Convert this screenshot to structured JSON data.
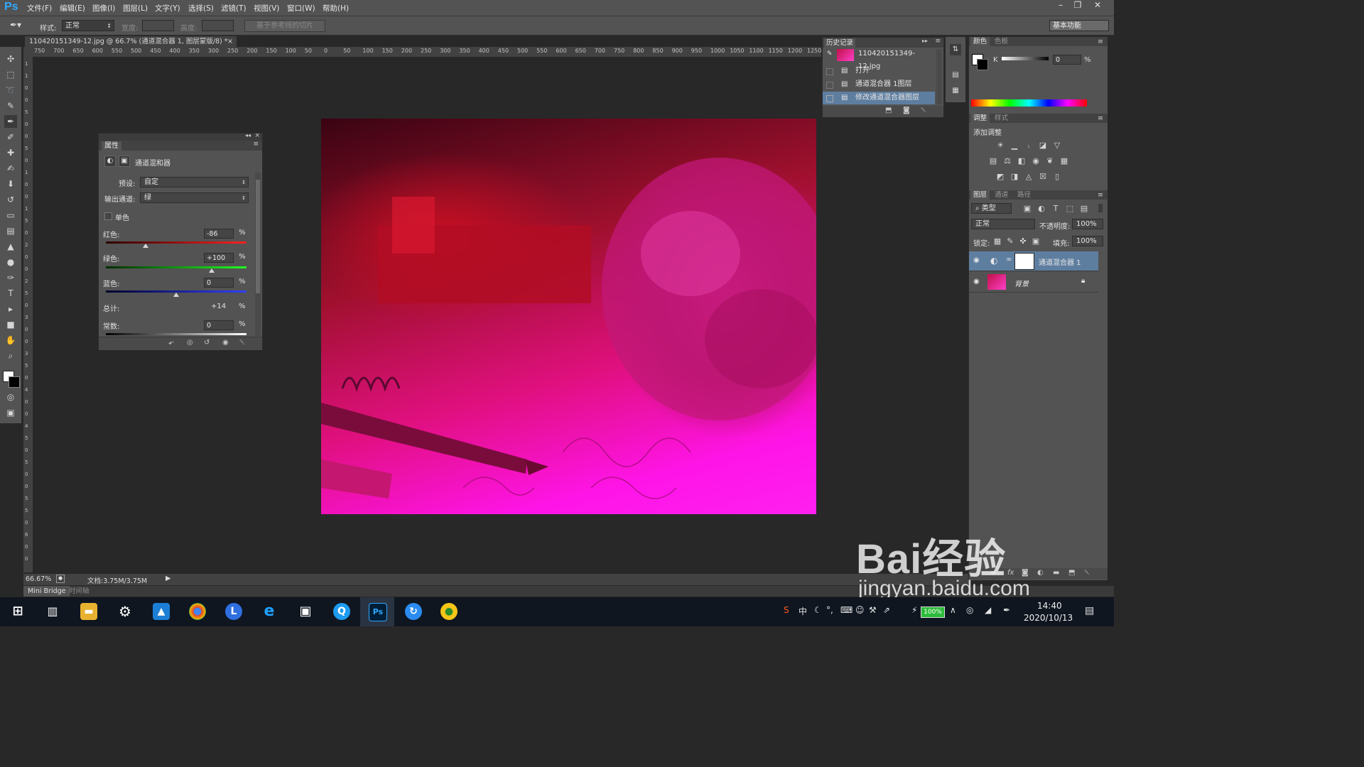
{
  "app": {
    "logo": "Ps",
    "workspace": "基本功能"
  },
  "menu": [
    "文件(F)",
    "编辑(E)",
    "图像(I)",
    "图层(L)",
    "文字(Y)",
    "选择(S)",
    "滤镜(T)",
    "视图(V)",
    "窗口(W)",
    "帮助(H)"
  ],
  "options": {
    "style_label": "样式:",
    "style_value": "正常",
    "width_label": "宽度:",
    "height_label": "高度:",
    "slice_button": "基于参考线的切片"
  },
  "document": {
    "tab_title": "110420151349-12.jpg @ 66.7% (通道混合器 1, 图层蒙版/8) *",
    "ruler_h": [
      "750",
      "700",
      "650",
      "600",
      "550",
      "500",
      "450",
      "400",
      "350",
      "300",
      "250",
      "200",
      "150",
      "100",
      "50",
      "0",
      "50",
      "100",
      "150",
      "200",
      "250",
      "300",
      "350",
      "400",
      "450",
      "500",
      "550",
      "600",
      "650",
      "700",
      "750",
      "800",
      "850",
      "900",
      "950",
      "1000",
      "1050",
      "1100",
      "1150",
      "1200",
      "1250"
    ],
    "ruler_v": [
      "1",
      "1",
      "0",
      "0",
      "5",
      "0",
      "0",
      "5",
      "0",
      "1",
      "0",
      "0",
      "1",
      "5",
      "0",
      "2",
      "0",
      "0",
      "2",
      "5",
      "0",
      "3",
      "0",
      "0",
      "3",
      "5",
      "0",
      "4",
      "0",
      "0",
      "4",
      "5",
      "0",
      "5",
      "0",
      "0",
      "5",
      "5",
      "0",
      "6",
      "0",
      "0"
    ]
  },
  "status": {
    "zoom": "66.67%",
    "doc_size": "文档:3.75M/3.75M"
  },
  "bottom_tabs": {
    "mini_bridge": "Mini Bridge",
    "timeline": "时间轴"
  },
  "properties": {
    "panel_title": "属性",
    "adjustment_name": "通道混和器",
    "preset_label": "预设:",
    "preset_value": "自定",
    "output_label": "输出通道:",
    "output_value": "绿",
    "mono_label": "单色",
    "red_label": "红色:",
    "red_value": "-86",
    "green_label": "绿色:",
    "green_value": "+100",
    "blue_label": "蓝色:",
    "blue_value": "0",
    "total_label": "总计:",
    "total_value": "+14",
    "constant_label": "常数:",
    "constant_value": "0",
    "percent": "%",
    "red_level": -86,
    "green_level": 100,
    "blue_level": 0,
    "constant_level": 0
  },
  "history": {
    "panel_title": "历史记录",
    "snapshot": "110420151349-12.jpg",
    "items": [
      "打开",
      "通道混合器 1图层",
      "修改通道混合器图层"
    ]
  },
  "color_panel": {
    "tab_color": "颜色",
    "tab_swatches": "色板",
    "k_label": "K",
    "k_value": "0",
    "percent": "%"
  },
  "adjust_panel": {
    "tab_adjust": "调整",
    "tab_styles": "样式",
    "add_label": "添加调整"
  },
  "layers_panel": {
    "tab_layers": "图层",
    "tab_channels": "通道",
    "tab_paths": "路径",
    "filter_value": "类型",
    "blend_value": "正常",
    "opacity_label": "不透明度:",
    "opacity_value": "100%",
    "lock_label": "锁定:",
    "fill_label": "填充:",
    "fill_value": "100%",
    "layers": [
      {
        "name": "通道混合器 1"
      },
      {
        "name": "背景"
      }
    ]
  },
  "taskbar": {
    "battery": "100%",
    "ime": "中",
    "time": "14:40",
    "date": "2020/10/13",
    "ps_icon_label": "Ps"
  },
  "watermark": {
    "logo_text": "Bai经验",
    "url": "jingyan.baidu.com"
  }
}
